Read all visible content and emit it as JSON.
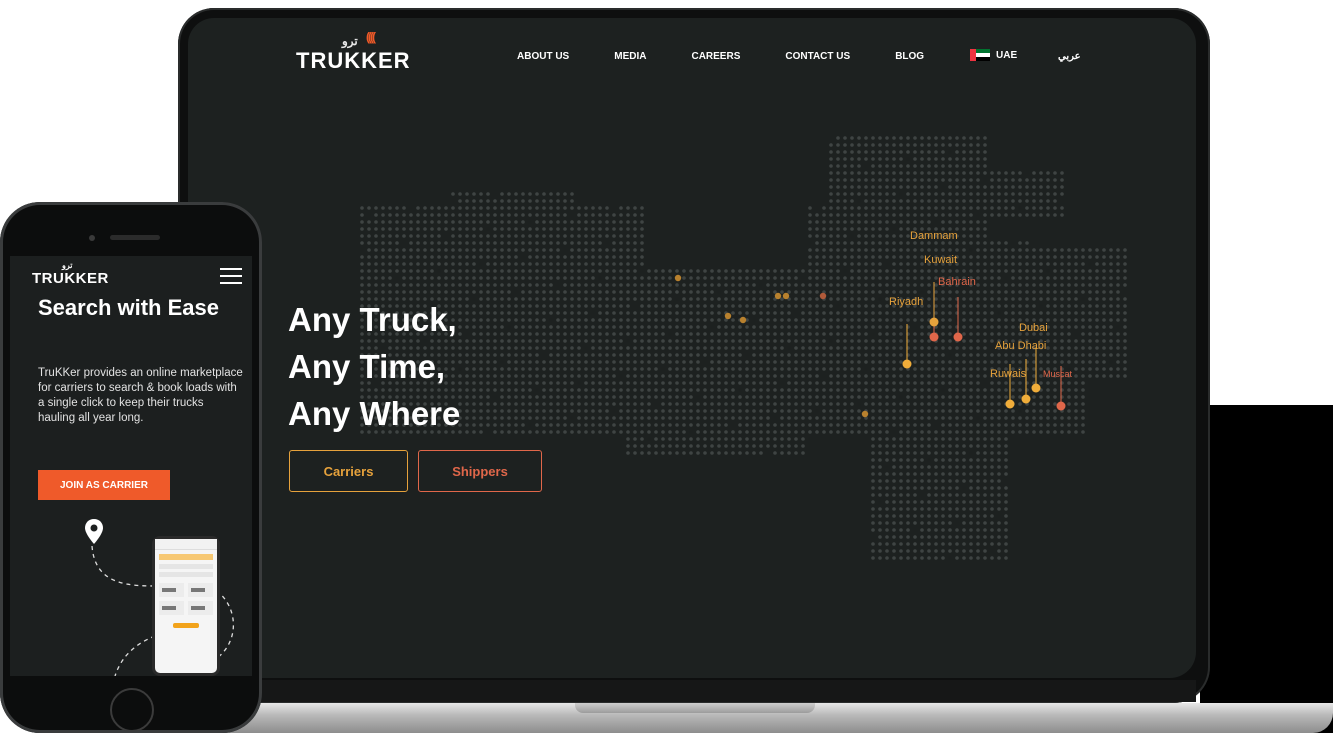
{
  "desktop": {
    "logo": {
      "text": "TRUKKER",
      "arabic": "ترو",
      "waves": "(((("
    },
    "nav": [
      "ABOUT US",
      "MEDIA",
      "CAREERS",
      "CONTACT US",
      "BLOG"
    ],
    "region": "UAE",
    "arabic_link": "عربي",
    "hero": {
      "line1": "Any Truck,",
      "line2": "Any Time,",
      "line3": "Any Where"
    },
    "buttons": {
      "carriers": "Carriers",
      "shippers": "Shippers"
    },
    "cities": [
      "Dammam",
      "Kuwait",
      "Bahrain",
      "Riyadh",
      "Dubai",
      "Abu Dhabi",
      "Ruwais",
      "Muscat"
    ]
  },
  "mobile": {
    "logo": {
      "text": "TRUKKER",
      "arabic": "ترو"
    },
    "title": "Search with Ease",
    "description": "TruKKer provides an online marketplace for carriers to search & book loads with a single click to keep their trucks hauling all year long.",
    "join_button": "JOIN AS CARRIER"
  },
  "colors": {
    "accent_orange": "#ef5a2a",
    "accent_gold": "#e6a23c",
    "screen_bg": "#1d2120"
  }
}
